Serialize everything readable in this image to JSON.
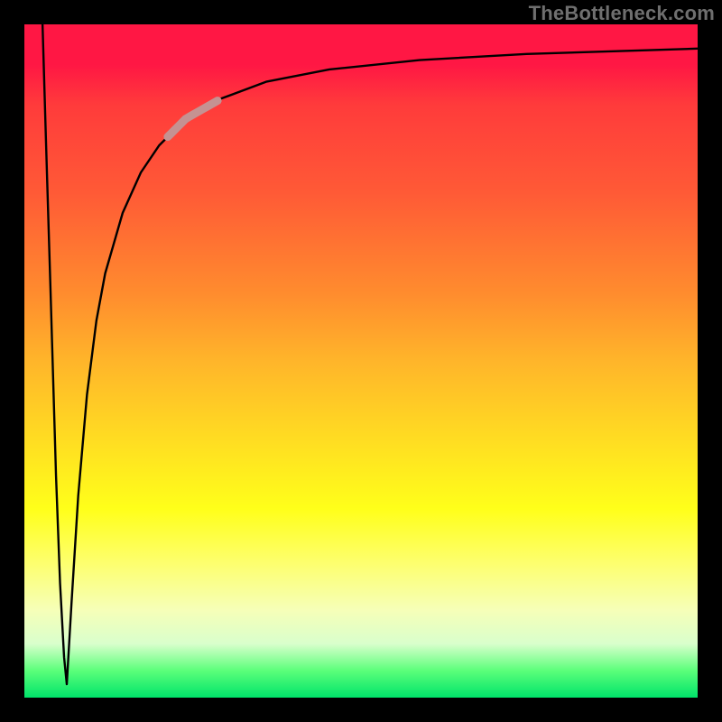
{
  "watermark": "TheBottleneck.com",
  "colors": {
    "frame": "#000000",
    "curve": "#000000",
    "highlight": "#c59292",
    "gradient_stops": [
      "#ff1744",
      "#ff5a36",
      "#ffb52a",
      "#ffff1a",
      "#f6ffb8",
      "#00e36a"
    ]
  },
  "chart_data": {
    "type": "line",
    "title": "",
    "xlabel": "",
    "ylabel": "",
    "xlim": [
      0,
      100
    ],
    "ylim": [
      0,
      100
    ],
    "grid": false,
    "legend": false,
    "series": [
      {
        "name": "bottleneck-curve-left-descent",
        "x": [
          2.7,
          3.2,
          3.9,
          4.7,
          5.3,
          5.9,
          6.3
        ],
        "y": [
          100,
          83,
          60,
          33,
          17,
          6,
          2
        ]
      },
      {
        "name": "bottleneck-curve-right-ascent",
        "x": [
          6.3,
          7.0,
          8.0,
          9.3,
          10.7,
          12.0,
          14.6,
          17.3,
          20.0,
          24.0,
          29.3,
          36.0,
          45.3,
          58.7,
          74.6,
          90.7,
          100
        ],
        "y": [
          2,
          14,
          30,
          45,
          56,
          63,
          72,
          78,
          82,
          86,
          89,
          91.5,
          93.3,
          94.7,
          95.6,
          96.1,
          96.4
        ]
      }
    ],
    "highlight_segment": {
      "comment": "light pink overlay band on curve",
      "x": [
        21.3,
        28.7
      ],
      "y": [
        78.3,
        84.7
      ]
    }
  }
}
